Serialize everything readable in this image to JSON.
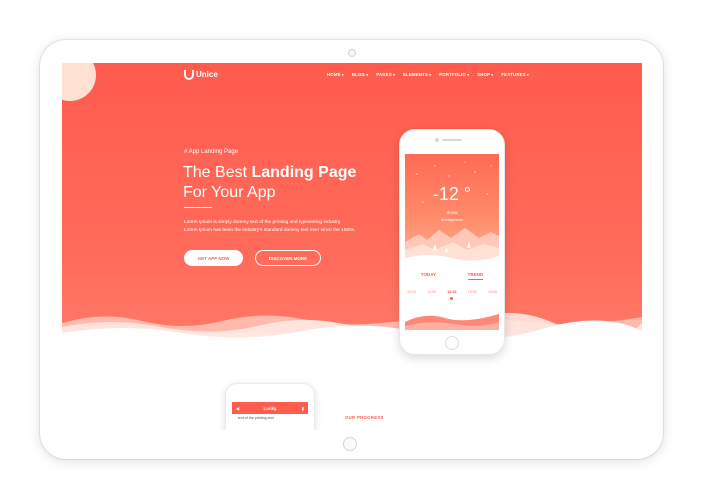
{
  "brand": {
    "name": "Unice"
  },
  "nav": {
    "items": [
      "HOME",
      "BLOG",
      "PAGES",
      "ELEMENTS",
      "PORTFOLIO",
      "SHOP",
      "FEATURES"
    ]
  },
  "hero": {
    "subtitle": "# App Landing Page",
    "title_plain_1": "The Best ",
    "title_bold": "Landing Page",
    "title_line2": "For Your App",
    "paragraph_line1": "Lorem Ipsum is simply dummy text of the printing and typesetting industry.",
    "paragraph_line2": "Lorem Ipsum has been the industry's standard dummy text ever since the 1500s.",
    "btn_primary": "GET APP NOW",
    "btn_secondary": "DISCOVER MORE"
  },
  "weather_app": {
    "temperature": "-12 °",
    "condition": "Snow",
    "location": "Madagascar",
    "tab_today": "TODAY",
    "tab_trend": "TREND",
    "times": [
      "10:00",
      "11:00",
      "12:00",
      "13:00",
      "14:00"
    ]
  },
  "second_phone": {
    "title": "Lucky",
    "text": "text of the printing and"
  },
  "section": {
    "progress_label": "OUR PROGRESS"
  },
  "colors": {
    "accent": "#ff5c4d",
    "white": "#ffffff"
  }
}
